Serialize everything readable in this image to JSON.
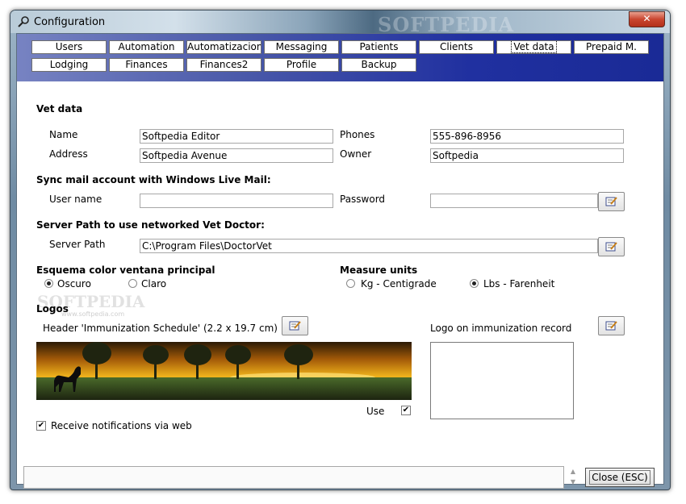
{
  "window": {
    "title": "Configuration",
    "close_glyph": "✕",
    "titlebar_watermark": "SOFTPEDIA"
  },
  "tabs": [
    {
      "label": "Users",
      "active": false
    },
    {
      "label": "Automation",
      "active": false
    },
    {
      "label": "Automatizacion2",
      "active": false
    },
    {
      "label": "Messaging",
      "active": false
    },
    {
      "label": "Patients",
      "active": false
    },
    {
      "label": "Clients",
      "active": false
    },
    {
      "label": "Vet data",
      "active": true
    },
    {
      "label": "Prepaid M.",
      "active": false
    },
    {
      "label": "Lodging",
      "active": false
    },
    {
      "label": "Finances",
      "active": false
    },
    {
      "label": "Finances2",
      "active": false
    },
    {
      "label": "Profile",
      "active": false
    },
    {
      "label": "Backup",
      "active": false
    }
  ],
  "vet_data": {
    "heading": "Vet data",
    "name_label": "Name",
    "name_value": "Softpedia Editor",
    "address_label": "Address",
    "address_value": "Softpedia Avenue",
    "phones_label": "Phones",
    "phones_value": "555-896-8956",
    "owner_label": "Owner",
    "owner_value": "Softpedia"
  },
  "sync": {
    "heading": "Sync mail account with Windows Live Mail:",
    "username_label": "User name",
    "username_value": "",
    "password_label": "Password",
    "password_value": ""
  },
  "server": {
    "heading": "Server Path to use networked Vet Doctor:",
    "path_label": "Server Path",
    "path_value": "C:\\Program Files\\DoctorVet"
  },
  "color_scheme": {
    "heading": "Esquema color ventana principal",
    "options": [
      {
        "label": "Oscuro",
        "selected": true
      },
      {
        "label": "Claro",
        "selected": false
      }
    ]
  },
  "measure_units": {
    "heading": "Measure units",
    "options": [
      {
        "label": "Kg - Centigrade",
        "selected": false
      },
      {
        "label": "Lbs - Farenheit",
        "selected": true
      }
    ]
  },
  "logos": {
    "heading": "Logos",
    "header_label": "Header 'Immunization Schedule' (2.2 x 19.7 cm)",
    "immunization_label": "Logo on immunization record",
    "use_label": "Use",
    "use_checked": true
  },
  "notifications": {
    "label": "Receive notifications via web",
    "checked": true
  },
  "footer": {
    "close_label": "Close (ESC)",
    "spin_up": "▲",
    "spin_down": "▼"
  },
  "watermark": {
    "text": "SOFTPEDIA",
    "url": "www.softpedia.com"
  },
  "icons": {
    "app": "wrench-search-icon",
    "edit": "edit-note-icon",
    "check": "✔"
  },
  "colors": {
    "tab_bar_start": "#7783c2",
    "tab_bar_end": "#1a2a96",
    "close_red": "#c9452f"
  }
}
